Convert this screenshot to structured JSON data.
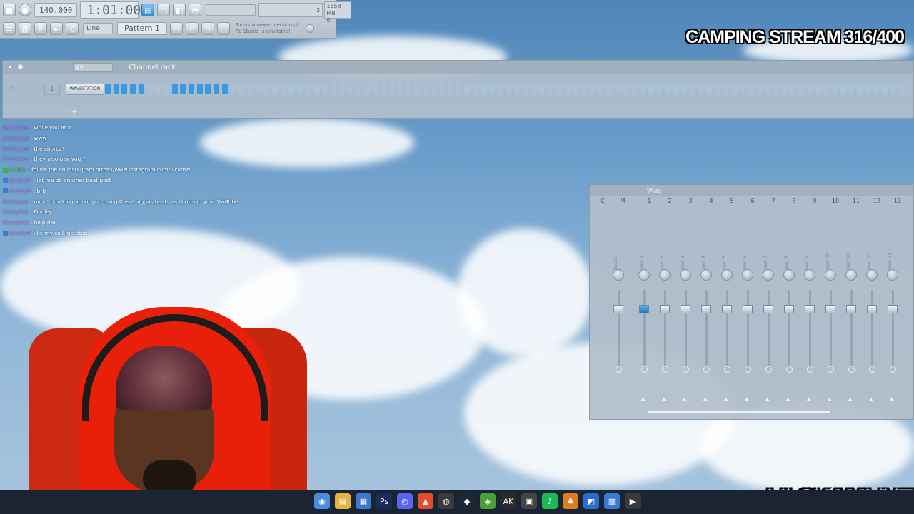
{
  "overlay": {
    "stream_title": "CAMPING STREAM 316/400",
    "channel_name": "LILSKAMLIVE"
  },
  "toolbar": {
    "tempo": "140.000",
    "time": "1:01:00",
    "cpu_top": "2",
    "cpu_bottom": "0",
    "memory": "1558 MB",
    "snap": "Line",
    "pattern": "Pattern 1",
    "news_line1": "Today  A newer version of",
    "news_line2": "FL Studio is available!"
  },
  "channel_rack": {
    "filter": "All",
    "title": "Channel rack",
    "channel_number": "1",
    "channel_name": "WAVESTATION",
    "add_label": "+",
    "step_colors": {
      "on": "#3a97e0",
      "off": "#a7c7e0"
    },
    "steps_total": 96,
    "steps_on": [
      0,
      1,
      2,
      3,
      4,
      8,
      9,
      10,
      11,
      12,
      13,
      14
    ]
  },
  "chat": [
    {
      "user": "KennyAce",
      "text": "while you at it",
      "badge": ""
    },
    {
      "user": "KennyAce",
      "text": "www",
      "badge": ""
    },
    {
      "user": "KennyAce",
      "text": "the shorts ?",
      "badge": ""
    },
    {
      "user": "KennyAce",
      "text": "they also pay you ?",
      "badge": ""
    },
    {
      "user": "DatBlu",
      "text": "follow me on instagram https://www.instagram.com/lilkamz/",
      "badge": "green"
    },
    {
      "user": "DooleyFr",
      "text": "let me do another beat post",
      "badge": "blue"
    },
    {
      "user": "DooleyFr",
      "text": "brb",
      "badge": "blue"
    },
    {
      "user": "KennyAce",
      "text": "nah I'm talking about you using these niggas beats as shorts in your YouTube",
      "badge": ""
    },
    {
      "user": "KennyAce",
      "text": "Dooley",
      "badge": ""
    },
    {
      "user": "KennyAce",
      "text": "help me",
      "badge": ""
    },
    {
      "user": "DooleyFr",
      "text": "kenny call me then",
      "badge": "blue"
    }
  ],
  "mixer": {
    "title": "Wide",
    "labels": [
      "C",
      "M",
      "1",
      "2",
      "3",
      "4",
      "5",
      "6",
      "7",
      "8",
      "9",
      "10",
      "11",
      "12",
      "13"
    ],
    "strips": [
      "Master",
      "Insert 1",
      "Insert 2",
      "Insert 3",
      "Insert 4",
      "Insert 5",
      "Insert 6",
      "Insert 7",
      "Insert 8",
      "Insert 9",
      "Insert 10",
      "Insert 11",
      "Insert 12",
      "Insert 13"
    ],
    "selected_strip": 1
  },
  "taskbar": {
    "icons": [
      "chrome-icon",
      "folder-icon",
      "store-icon",
      "photoshop-icon",
      "discord-icon",
      "brave-icon",
      "obs-icon",
      "steam-icon",
      "app-icon",
      "ak-icon",
      "app-icon-2",
      "spotify-icon",
      "fl-studio-icon",
      "app-icon-3",
      "notes-icon",
      "media-icon"
    ],
    "icon_labels": [
      "◉",
      "▤",
      "▦",
      "Ps",
      "◎",
      "▲",
      "◍",
      "◆",
      "◈",
      "AK",
      "▣",
      "♪",
      "♣",
      "◩",
      "▥",
      "▶"
    ],
    "icon_colors": [
      "#4a8be0",
      "#e5b43c",
      "#3a78d6",
      "#1c2c5a",
      "#5865f2",
      "#e84a2a",
      "#3a3a3a",
      "#1b2838",
      "#4aa038",
      "#2a2a2a",
      "#444",
      "#1db954",
      "#e07a1a",
      "#2a6ecc",
      "#3a7ad0",
      "#3a3a3a"
    ]
  }
}
